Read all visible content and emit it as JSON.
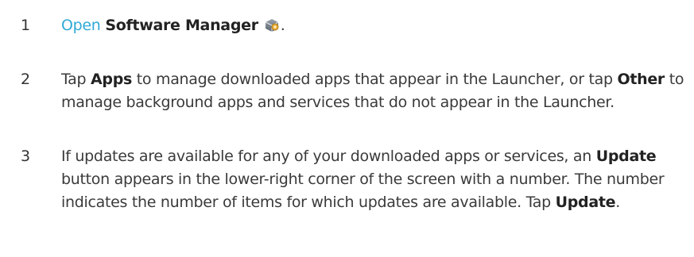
{
  "steps": [
    {
      "number": "1",
      "parts": {
        "link": "Open",
        "bold_app": "Software Manager",
        "end": "."
      },
      "icon": "software-manager-icon"
    },
    {
      "number": "2",
      "parts": {
        "t1": "Tap ",
        "b1": "Apps",
        "t2": " to manage downloaded apps that appear in the Launcher, or tap ",
        "b2": "Other",
        "t3": " to manage background apps and services that do not appear in the Launcher."
      }
    },
    {
      "number": "3",
      "parts": {
        "t1": "If updates are available for any of your downloaded apps or services, an ",
        "b1": "Update",
        "t2": " button appears in the lower-right corner of the screen with a number. The number indicates the number of items for which updates are available. Tap ",
        "b2": "Update",
        "t3": "."
      }
    }
  ],
  "colors": {
    "text": "#3a3a3a",
    "link": "#31a9d6",
    "bold": "#222222"
  }
}
